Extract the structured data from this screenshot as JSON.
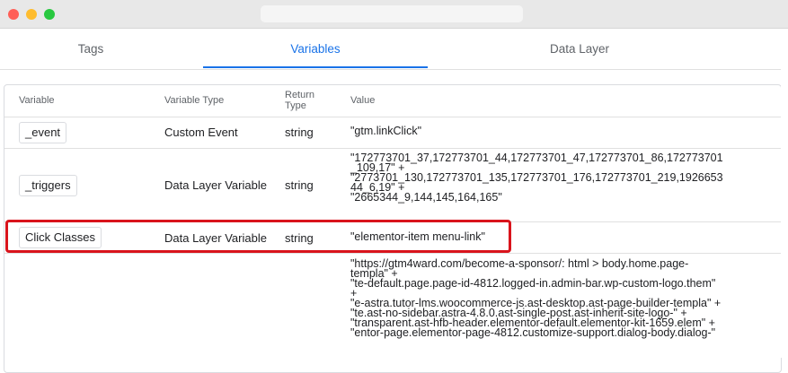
{
  "tabs": [
    {
      "label": "Tags"
    },
    {
      "label": "Variables"
    },
    {
      "label": "Data Layer"
    }
  ],
  "table": {
    "headers": {
      "variable": "Variable",
      "variable_type": "Variable Type",
      "return_type_line1": "Return",
      "return_type_line2": "Type",
      "value": "Value"
    },
    "rows": [
      {
        "name": "_event",
        "type": "Custom Event",
        "return_type": "string",
        "value_lines": [
          "\"gtm.linkClick\""
        ]
      },
      {
        "name": "_triggers",
        "type": "Data Layer Variable",
        "return_type": "string",
        "value_lines": [
          "\"172773701_37,172773701_44,172773701_47,172773701_86,172773701",
          "_109,17\" +",
          "\"2773701_130,172773701_135,172773701_176,172773701_219,1926653",
          "44_6,19\" +",
          "\"2665344_9,144,145,164,165\""
        ]
      },
      {
        "name": "Click Classes",
        "type": "Data Layer Variable",
        "return_type": "string",
        "value_lines": [
          "\"elementor-item menu-link\""
        ]
      },
      {
        "name": "",
        "type": "",
        "return_type": "",
        "value_lines": [
          "\"https://gtm4ward.com/become-a-sponsor/: html > body.home.page-",
          "templa\" +",
          "\"te-default.page.page-id-4812.logged-in.admin-bar.wp-custom-logo.them\"",
          "+",
          "\"e-astra.tutor-lms.woocommerce-js.ast-desktop.ast-page-builder-templa\" +",
          "\"te.ast-no-sidebar.astra-4.8.0.ast-single-post.ast-inherit-site-logo-\" +",
          "\"transparent.ast-hfb-header.elementor-default.elementor-kit-1659.elem\" +",
          "\"entor-page.elementor-page-4812.customize-support.dialog-body.dialog-\""
        ]
      }
    ]
  },
  "colors": {
    "accent": "#1a73e8",
    "highlight": "#d9141c"
  }
}
